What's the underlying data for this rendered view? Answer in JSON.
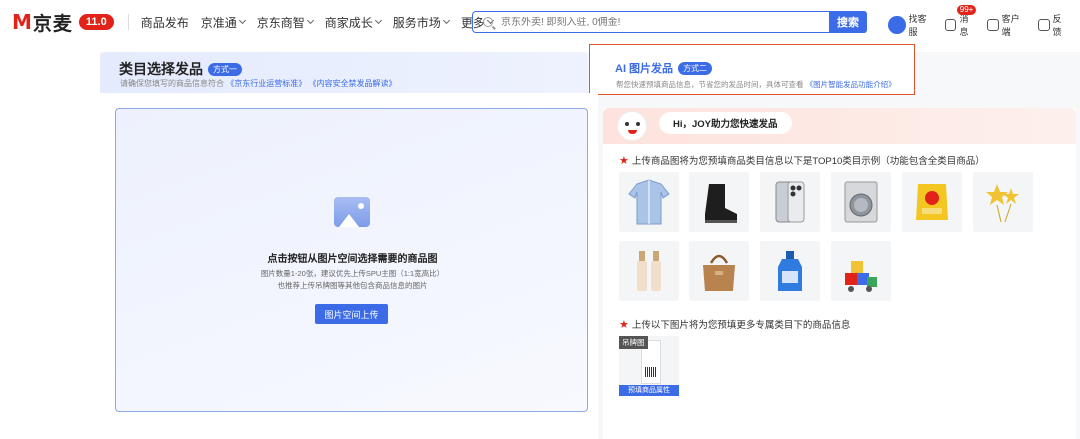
{
  "header": {
    "logo_letter": "M",
    "logo_text": "京麦",
    "version": "11.0",
    "nav": [
      {
        "label": "商品发布",
        "chevron": false
      },
      {
        "label": "京准通",
        "chevron": true
      },
      {
        "label": "京东商智",
        "chevron": true
      },
      {
        "label": "商家成长",
        "chevron": true
      },
      {
        "label": "服务市场",
        "chevron": true
      },
      {
        "label": "更多",
        "chevron": true
      }
    ],
    "search_placeholder": "京东外卖! 即刻入驻, 0佣金!",
    "search_button": "搜索",
    "tools": {
      "agent": "找客服",
      "messages": "消息",
      "messages_badge": "99+",
      "client": "客户端",
      "feedback": "反馈"
    }
  },
  "tab1": {
    "title": "类目选择发品",
    "pill": "方式一",
    "desc_prefix": "请确保您填写的商品信息符合",
    "link1": "《京东行业运营标准》",
    "link2": "《内容安全禁发品解读》"
  },
  "tab2": {
    "title": "AI 图片发品",
    "pill": "方式二",
    "desc_prefix": "帮您快速预填商品信息，节省您的发品时间，具体可查看",
    "link": "《图片智能发品功能介绍》"
  },
  "upload": {
    "title": "点击按钮从图片空间选择需要的商品图",
    "desc1": "图片数量1-20张，建议优先上传SPU主图（1:1宽高比）",
    "desc2": "也推荐上传吊牌图等其他包含商品信息的图片",
    "button": "图片空间上传"
  },
  "joy": {
    "greeting": "Hi，JOY助力您快速发品",
    "section1": "上传商品图将为您预填商品类目信息以下是TOP10类目示例（功能包含全类目商品）",
    "section2": "上传以下图片将为您预填更多专属类目下的商品信息",
    "products": [
      "shirt-icon",
      "boot-icon",
      "phone-icon",
      "washer-icon",
      "chips-icon",
      "star-balloon-icon",
      "cosmetics-icon",
      "handbag-icon",
      "detergent-icon",
      "toy-blocks-icon"
    ],
    "tag_label": "吊牌图",
    "tag_foot": "预填商品属性"
  }
}
